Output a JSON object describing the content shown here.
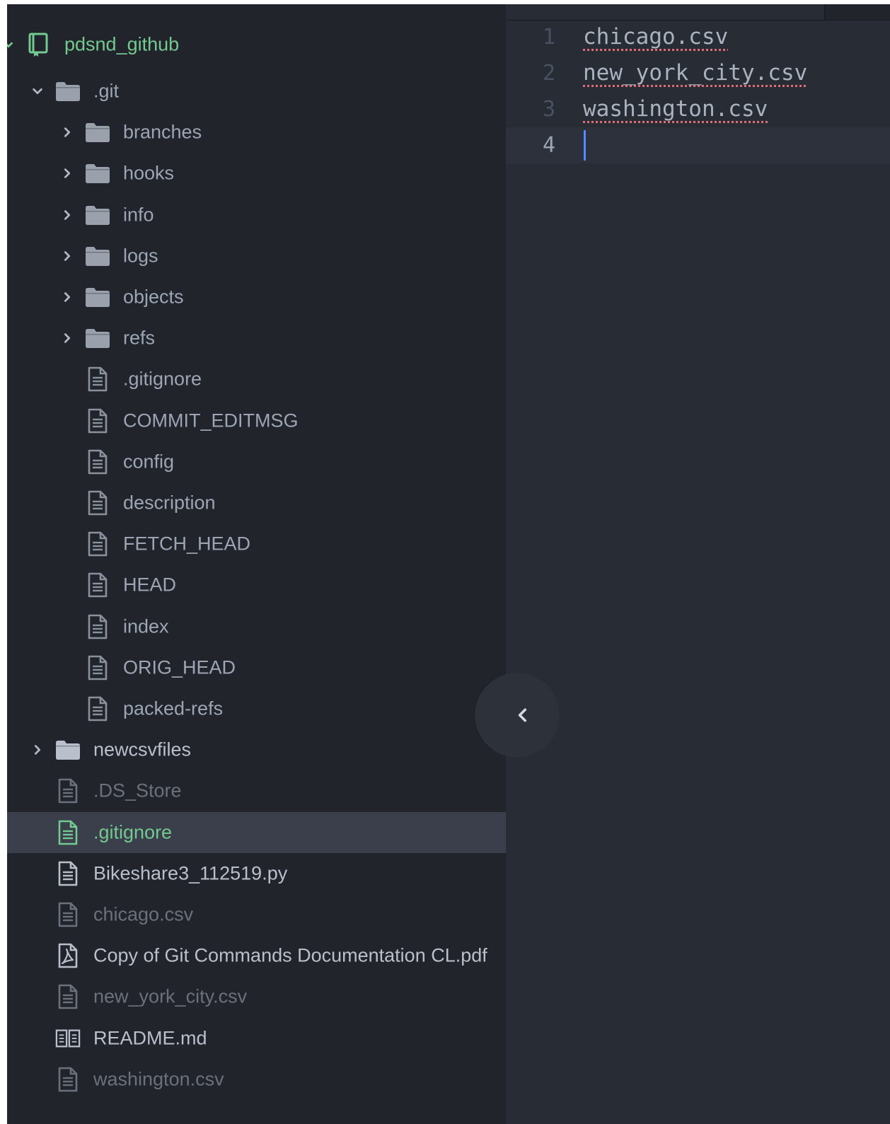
{
  "project": {
    "name": "pdsnd_github"
  },
  "tree": [
    {
      "label": ".git",
      "type": "folder",
      "depth": 1,
      "expanded": true,
      "tone": "normal"
    },
    {
      "label": "branches",
      "type": "folder",
      "depth": 2,
      "expanded": false,
      "tone": "normal"
    },
    {
      "label": "hooks",
      "type": "folder",
      "depth": 2,
      "expanded": false,
      "tone": "normal"
    },
    {
      "label": "info",
      "type": "folder",
      "depth": 2,
      "expanded": false,
      "tone": "normal"
    },
    {
      "label": "logs",
      "type": "folder",
      "depth": 2,
      "expanded": false,
      "tone": "normal"
    },
    {
      "label": "objects",
      "type": "folder",
      "depth": 2,
      "expanded": false,
      "tone": "normal"
    },
    {
      "label": "refs",
      "type": "folder",
      "depth": 2,
      "expanded": false,
      "tone": "normal"
    },
    {
      "label": ".gitignore",
      "type": "file",
      "depth": 2,
      "tone": "normal"
    },
    {
      "label": "COMMIT_EDITMSG",
      "type": "file",
      "depth": 2,
      "tone": "normal"
    },
    {
      "label": "config",
      "type": "file",
      "depth": 2,
      "tone": "normal"
    },
    {
      "label": "description",
      "type": "file",
      "depth": 2,
      "tone": "normal"
    },
    {
      "label": "FETCH_HEAD",
      "type": "file",
      "depth": 2,
      "tone": "normal"
    },
    {
      "label": "HEAD",
      "type": "file",
      "depth": 2,
      "tone": "normal"
    },
    {
      "label": "index",
      "type": "file",
      "depth": 2,
      "tone": "normal"
    },
    {
      "label": "ORIG_HEAD",
      "type": "file",
      "depth": 2,
      "tone": "normal"
    },
    {
      "label": "packed-refs",
      "type": "file",
      "depth": 2,
      "tone": "normal"
    },
    {
      "label": "newcsvfiles",
      "type": "folder",
      "depth": 1,
      "expanded": false,
      "tone": "bright"
    },
    {
      "label": ".DS_Store",
      "type": "file",
      "depth": 1,
      "tone": "dim"
    },
    {
      "label": ".gitignore",
      "type": "file",
      "depth": 1,
      "tone": "green",
      "selected": true
    },
    {
      "label": "Bikeshare3_112519.py",
      "type": "file",
      "depth": 1,
      "tone": "bright"
    },
    {
      "label": "chicago.csv",
      "type": "file",
      "depth": 1,
      "tone": "dim"
    },
    {
      "label": "Copy of Git Commands Documentation CL.pdf",
      "type": "pdf",
      "depth": 1,
      "tone": "bright"
    },
    {
      "label": "new_york_city.csv",
      "type": "file",
      "depth": 1,
      "tone": "dim"
    },
    {
      "label": "README.md",
      "type": "book",
      "depth": 1,
      "tone": "bright"
    },
    {
      "label": "washington.csv",
      "type": "file",
      "depth": 1,
      "tone": "dim"
    }
  ],
  "editor": {
    "lines": [
      {
        "number": "1",
        "text": "chicago.csv",
        "misspelled": true
      },
      {
        "number": "2",
        "text": "new_york_city.csv",
        "misspelled": true
      },
      {
        "number": "3",
        "text": "washington.csv",
        "misspelled": true
      },
      {
        "number": "4",
        "text": "",
        "misspelled": false,
        "cursor": true
      }
    ]
  },
  "colors": {
    "background": "#21252b",
    "editor_background": "#282c34",
    "selection": "#3a3f4b",
    "text": "#9da5b4",
    "git_added": "#73c990",
    "cursor": "#528bff",
    "spell_error": "#e06c75"
  },
  "icons": {
    "project": "repo-icon",
    "folder": "folder-icon",
    "file": "file-text-icon",
    "pdf": "file-pdf-icon",
    "book": "book-icon",
    "expanded": "chevron-down-icon",
    "collapsed": "chevron-right-icon",
    "dock_toggle": "chevron-left-icon"
  }
}
